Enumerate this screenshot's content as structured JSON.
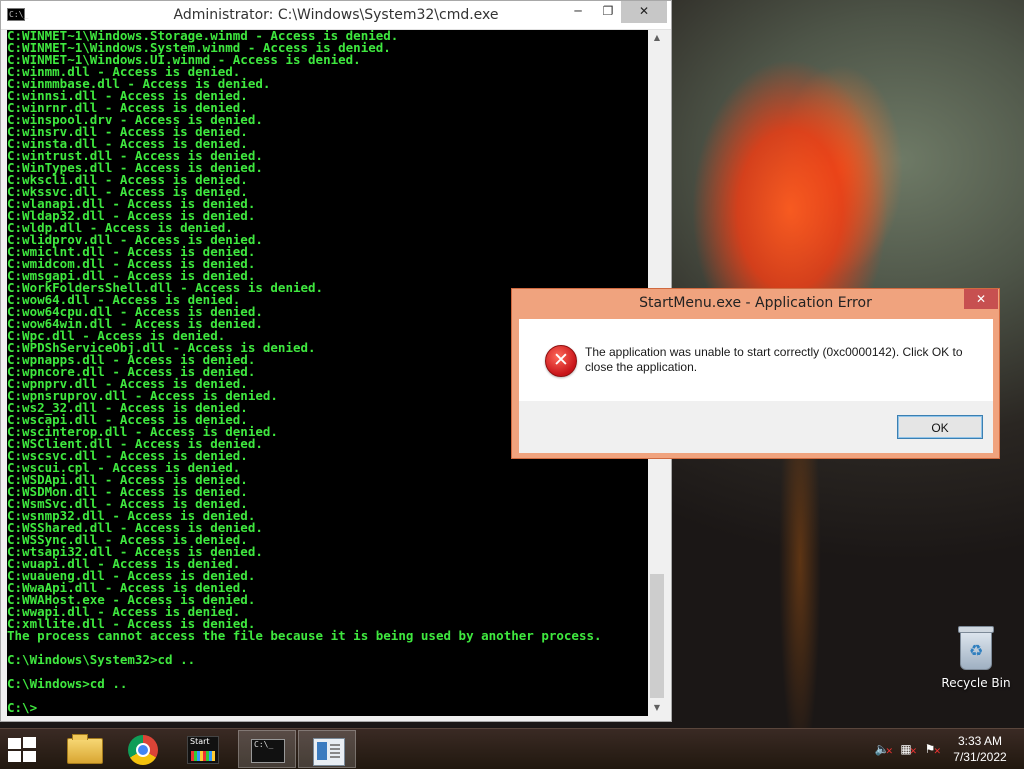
{
  "cmd": {
    "title": "Administrator: C:\\Windows\\System32\\cmd.exe",
    "icon_text": "C:\\_",
    "lines": [
      "C:WINMET~1\\Windows.Storage.winmd - Access is denied.",
      "C:WINMET~1\\Windows.System.winmd - Access is denied.",
      "C:WINMET~1\\Windows.UI.winmd - Access is denied.",
      "C:winmm.dll - Access is denied.",
      "C:winmmbase.dll - Access is denied.",
      "C:winnsi.dll - Access is denied.",
      "C:winrnr.dll - Access is denied.",
      "C:winspool.drv - Access is denied.",
      "C:winsrv.dll - Access is denied.",
      "C:winsta.dll - Access is denied.",
      "C:wintrust.dll - Access is denied.",
      "C:WinTypes.dll - Access is denied.",
      "C:wkscli.dll - Access is denied.",
      "C:wkssvc.dll - Access is denied.",
      "C:wlanapi.dll - Access is denied.",
      "C:Wldap32.dll - Access is denied.",
      "C:wldp.dll - Access is denied.",
      "C:wlidprov.dll - Access is denied.",
      "C:wmiclnt.dll - Access is denied.",
      "C:wmidcom.dll - Access is denied.",
      "C:wmsgapi.dll - Access is denied.",
      "C:WorkFoldersShell.dll - Access is denied.",
      "C:wow64.dll - Access is denied.",
      "C:wow64cpu.dll - Access is denied.",
      "C:wow64win.dll - Access is denied.",
      "C:Wpc.dll - Access is denied.",
      "C:WPDShServiceObj.dll - Access is denied.",
      "C:wpnapps.dll - Access is denied.",
      "C:wpncore.dll - Access is denied.",
      "C:wpnprv.dll - Access is denied.",
      "C:wpnsruprov.dll - Access is denied.",
      "C:ws2_32.dll - Access is denied.",
      "C:wscapi.dll - Access is denied.",
      "C:wscinterop.dll - Access is denied.",
      "C:WSClient.dll - Access is denied.",
      "C:wscsvc.dll - Access is denied.",
      "C:wscui.cpl - Access is denied.",
      "C:WSDApi.dll - Access is denied.",
      "C:WSDMon.dll - Access is denied.",
      "C:WsmSvc.dll - Access is denied.",
      "C:wsnmp32.dll - Access is denied.",
      "C:WSShared.dll - Access is denied.",
      "C:WSSync.dll - Access is denied.",
      "C:wtsapi32.dll - Access is denied.",
      "C:wuapi.dll - Access is denied.",
      "C:wuaueng.dll - Access is denied.",
      "C:WwaApi.dll - Access is denied.",
      "C:WWAHost.exe - Access is denied.",
      "C:wwapi.dll - Access is denied.",
      "C:xmllite.dll - Access is denied.",
      "The process cannot access the file because it is being used by another process.",
      "",
      "C:\\Windows\\System32>cd ..",
      "",
      "C:\\Windows>cd ..",
      "",
      "C:\\>"
    ]
  },
  "dialog": {
    "title": "StartMenu.exe - Application Error",
    "close_symbol": "✕",
    "icon_symbol": "✕",
    "message": "The application was unable to start correctly (0xc0000142). Click OK to close the application.",
    "ok_label": "OK"
  },
  "desktop": {
    "recycle_bin_label": "Recycle Bin"
  },
  "taskbar": {
    "start_app_label": "Start",
    "cmd_icon_text": "C:\\_",
    "clock_time": "3:33 AM",
    "clock_date": "7/31/2022"
  }
}
